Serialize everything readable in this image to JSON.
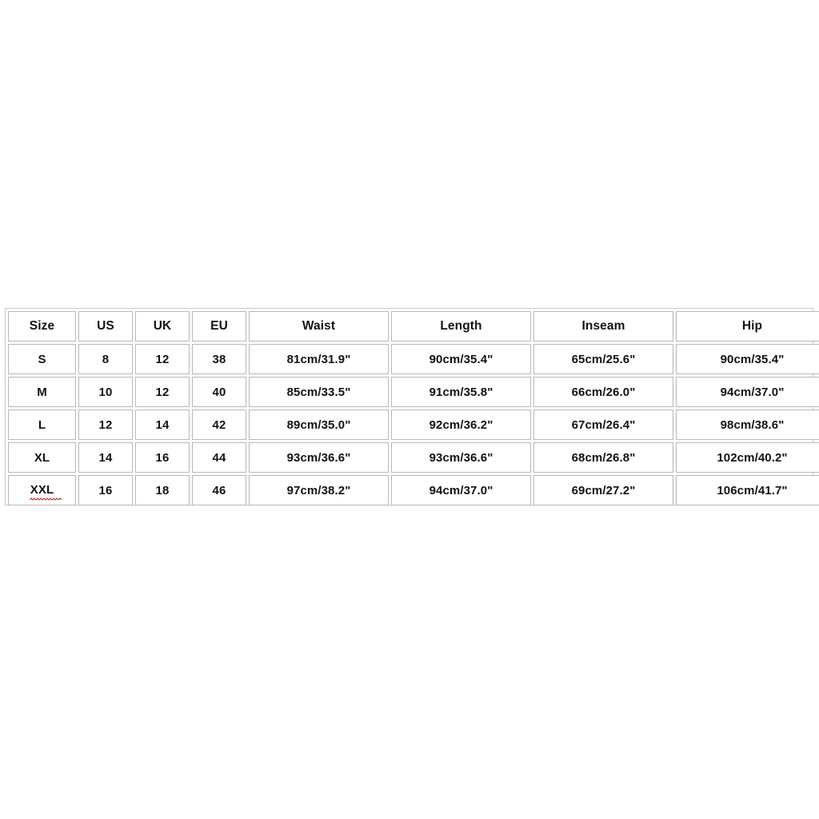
{
  "chart": {
    "name": "size-chart",
    "columns": [
      "Size",
      "US",
      "UK",
      "EU",
      "Waist",
      "Length",
      "Inseam",
      "Hip"
    ],
    "rows": [
      {
        "size": "S",
        "us": "8",
        "uk": "12",
        "eu": "38",
        "waist": "81cm/31.9\"",
        "length": "90cm/35.4\"",
        "inseam": "65cm/25.6\"",
        "hip": "90cm/35.4\""
      },
      {
        "size": "M",
        "us": "10",
        "uk": "12",
        "eu": "40",
        "waist": "85cm/33.5\"",
        "length": "91cm/35.8\"",
        "inseam": "66cm/26.0\"",
        "hip": "94cm/37.0\""
      },
      {
        "size": "L",
        "us": "12",
        "uk": "14",
        "eu": "42",
        "waist": "89cm/35.0\"",
        "length": "92cm/36.2\"",
        "inseam": "67cm/26.4\"",
        "hip": "98cm/38.6\""
      },
      {
        "size": "XL",
        "us": "14",
        "uk": "16",
        "eu": "44",
        "waist": "93cm/36.6\"",
        "length": "93cm/36.6\"",
        "inseam": "68cm/26.8\"",
        "hip": "102cm/40.2\""
      },
      {
        "size": "XXL",
        "us": "16",
        "uk": "18",
        "eu": "46",
        "waist": "97cm/38.2\"",
        "length": "94cm/37.0\"",
        "inseam": "69cm/27.2\"",
        "hip": "106cm/41.7\""
      }
    ]
  },
  "colors": {
    "page_background": "#ffffff",
    "cell_background": "#ffffff",
    "cell_border": "#b8b8b8",
    "outer_border": "#c9c9c9",
    "text": "#131313",
    "spellcheck_underline": "#b52b3a"
  }
}
